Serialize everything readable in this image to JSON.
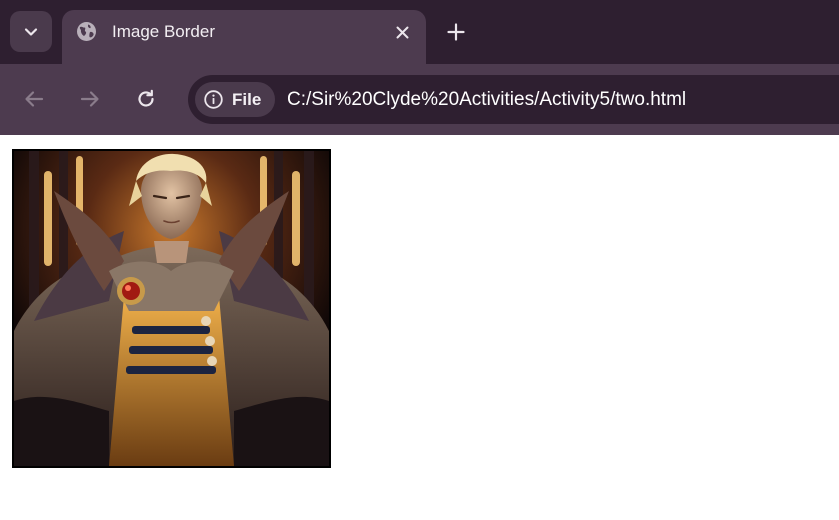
{
  "browser": {
    "tab": {
      "title": "Image Border",
      "favicon": "globe-icon"
    },
    "tab_search_icon": "chevron-down-icon",
    "close_icon": "close-icon",
    "new_tab_icon": "plus-icon",
    "nav": {
      "back_icon": "arrow-left-icon",
      "forward_icon": "arrow-right-icon",
      "reload_icon": "reload-icon"
    },
    "address_bar": {
      "site_chip_icon": "info-icon",
      "site_chip_label": "File",
      "url": "C:/Sir%20Clyde%20Activities/Activity5/two.html"
    }
  },
  "page": {
    "image": {
      "description_icon": "bordered-portrait-image",
      "border_color": "#000000"
    }
  },
  "colors": {
    "tabstrip_bg": "#2e1f30",
    "toolbar_bg": "#4d3b4f",
    "omnibox_bg": "#2e1f30",
    "page_bg": "#ffffff"
  }
}
